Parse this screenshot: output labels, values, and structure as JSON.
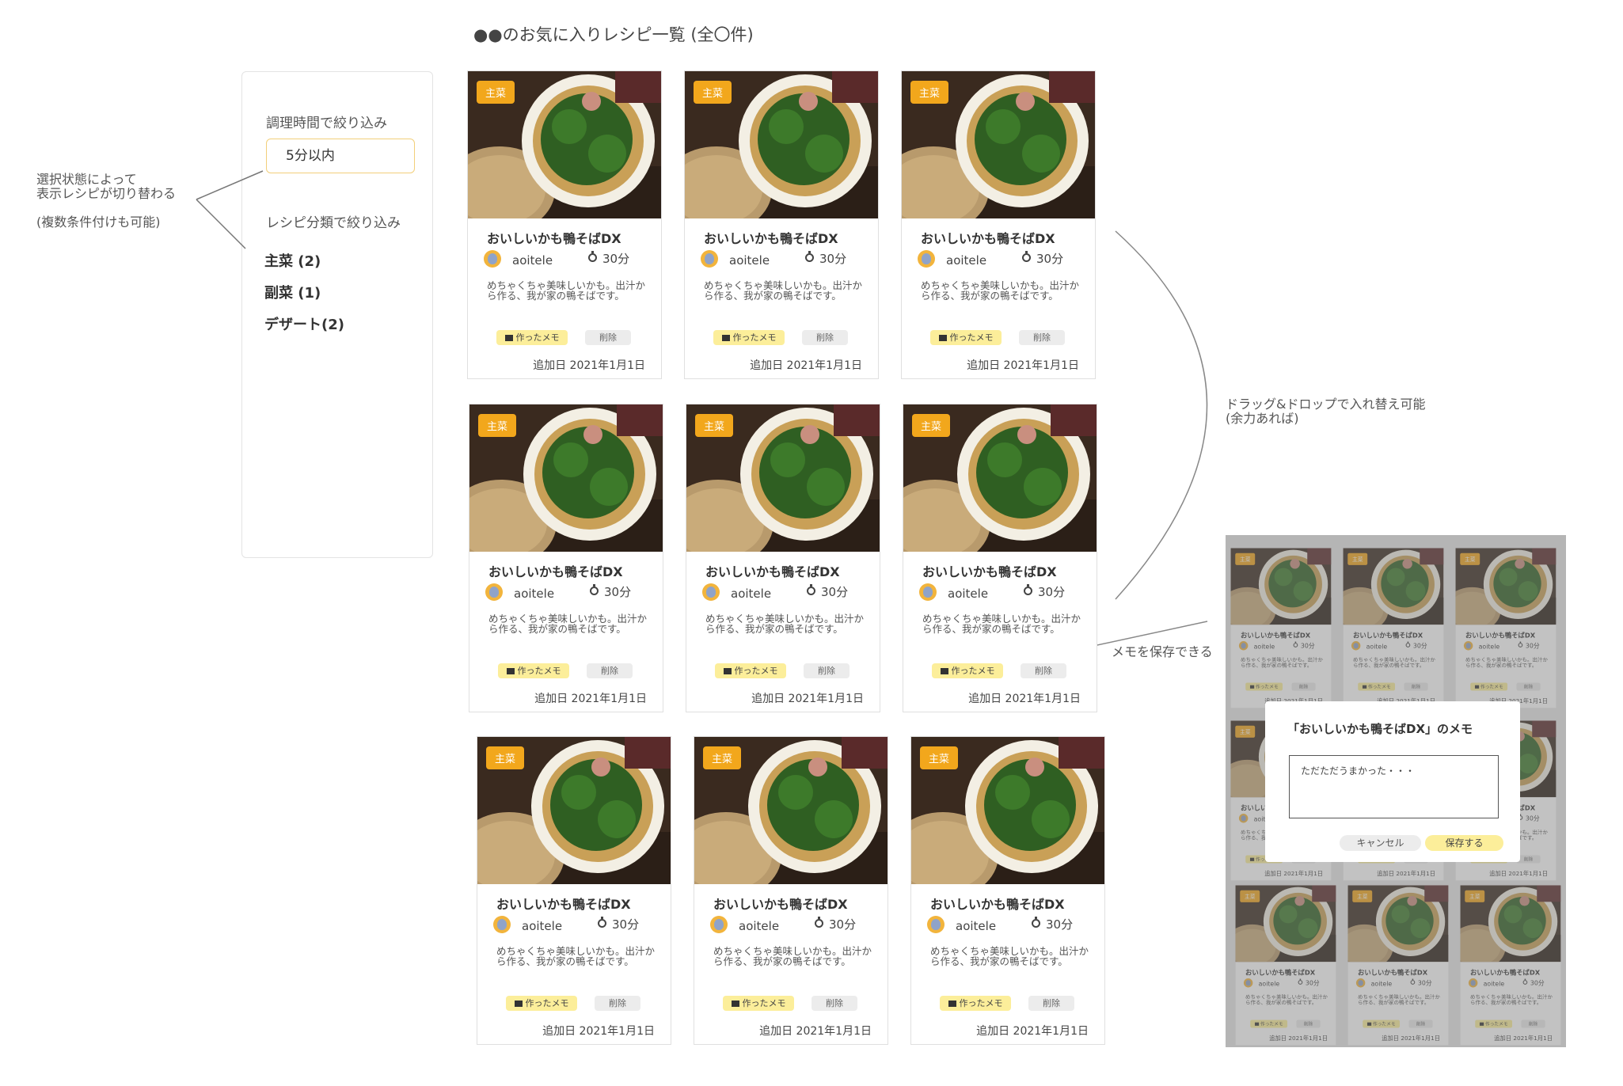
{
  "page_title": "●●のお気に入りレシピ一覧 (全〇件)",
  "filters": {
    "time_label": "調理時間で絞り込み",
    "time_value": "5分以内",
    "category_label": "レシピ分類で絞り込み",
    "categories": [
      {
        "label": "主菜 (2)"
      },
      {
        "label": "副菜 (1)"
      },
      {
        "label": "デザート(2)"
      }
    ]
  },
  "notes": {
    "filter_note": "選択状態によって\n表示レシピが切り替わる",
    "filter_note2": "(複数条件付けも可能)",
    "drag_note": "ドラッグ&ドロップで入れ替え可能\n(余力あれば)",
    "memo_note": "メモを保存できる"
  },
  "card": {
    "badge": "主菜",
    "title": "おいしいかも鴨そばDX",
    "author": "aoitele",
    "time": "30分",
    "description": "めちゃくちゃ美味しいかも。出汁から作る、我が家の鴨そばです。",
    "memo_button": "作ったメモ",
    "delete_button": "削除",
    "added_date": "追加日 2021年1月1日"
  },
  "modal": {
    "title": "「おいしいかも鴨そばDX」のメモ",
    "memo_text": "ただただうまかった・・・",
    "cancel": "キャンセル",
    "save": "保存する"
  },
  "colors": {
    "badge": "#f2a71c",
    "memo_button": "#fcee9a",
    "accent_border": "#f2cf7a"
  }
}
